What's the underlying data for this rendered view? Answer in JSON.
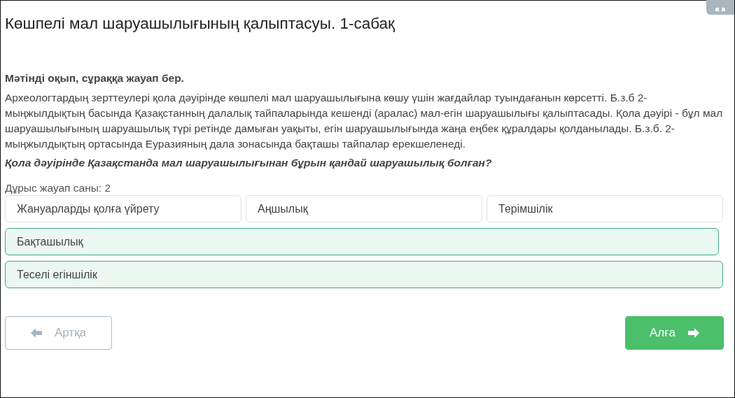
{
  "title": "Көшпелі мал шаруашылығының қалыптасуы. 1-сабақ",
  "instruction": "Мәтінді оқып, сұраққа жауап бер.",
  "passage": "Археологтардың зерттеулері қола дәуірінде көшпелі мал шаруашылығына көшу үшін жағдайлар туындағанын көрсетті. Б.з.б 2-мыңжылдықтың басында Қазақстанның далалық тайпаларында кешенді (аралас) мал-егін шаруашылығы қалыптасады. Қола дәуірі - бұл мал шаруашылығының шаруашылық түрі ретінде дамыған уақыты, егін шаруашылығында жаңа еңбек құралдары қолданылады. Б.з.б. 2-мыңжылдықтың ортасында Еуразияның дала зонасында бақташы тайпалар ерекшеленеді.",
  "question": "Қола дәуірінде Қазақстанда мал шаруашылығынан бұрын қандай шаруашылық болған?",
  "answer_count": "Дұрыс жауап саны: 2",
  "options": [
    {
      "label": "Жануарларды қолға үйрету",
      "selected": false
    },
    {
      "label": "Аңшылық",
      "selected": false
    },
    {
      "label": "Терімшілік",
      "selected": false
    },
    {
      "label": "Бақташылық",
      "selected": true
    },
    {
      "label": "Теселі егіншілік",
      "selected": true
    }
  ],
  "buttons": [
    {
      "label": "Артқа",
      "kind": "back"
    },
    {
      "label": "Алға",
      "kind": "next"
    }
  ]
}
